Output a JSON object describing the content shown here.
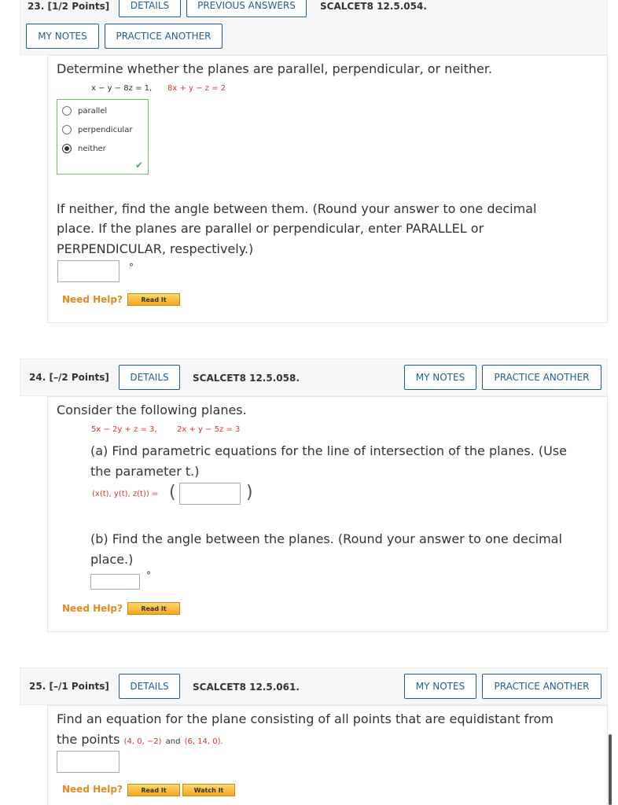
{
  "q23": {
    "header": {
      "number": "23.",
      "points": "[1/2 Points]",
      "details": "DETAILS",
      "previous_answers": "PREVIOUS ANSWERS",
      "code": "SCALCET8 12.5.054.",
      "my_notes": "MY NOTES",
      "practice_another": "PRACTICE ANOTHER"
    },
    "prompt": "Determine whether the planes are parallel, perpendicular, or neither.",
    "eq1": "x − y − 8z = 1,",
    "eq2": "8x + y − z = 2",
    "choices": [
      "parallel",
      "perpendicular",
      "neither"
    ],
    "selected_choice": "neither",
    "part2_lines": [
      "If neither, find the angle between them. (Round your answer to one decimal",
      "place. If the planes are parallel or perpendicular, enter PARALLEL or",
      "PERPENDICULAR, respectively.)"
    ],
    "answer_value": "",
    "degree": "°",
    "need_help": "Need Help?",
    "read_it": "Read It"
  },
  "q24": {
    "header": {
      "number": "24.",
      "points": "[–/2 Points]",
      "details": "DETAILS",
      "code": "SCALCET8 12.5.058.",
      "my_notes": "MY NOTES",
      "practice_another": "PRACTICE ANOTHER"
    },
    "prompt": "Consider the following planes.",
    "eq1": "5x − 2y + z = 3,",
    "eq2": "2x + y − 5z = 3",
    "part_a_lines": [
      "(a) Find parametric equations for the line of intersection of the planes. (Use",
      "the parameter t.)"
    ],
    "param_label": "(x(t), y(t), z(t)) =",
    "answer_a": "",
    "part_b_lines": [
      "(b) Find the angle between the planes. (Round your answer to one decimal",
      "place.)"
    ],
    "answer_b": "",
    "degree": "°",
    "need_help": "Need Help?",
    "read_it": "Read It"
  },
  "q25": {
    "header": {
      "number": "25.",
      "points": "[–/1 Points]",
      "details": "DETAILS",
      "code": "SCALCET8 12.5.061.",
      "my_notes": "MY NOTES",
      "practice_another": "PRACTICE ANOTHER"
    },
    "prompt_line1": "Find an equation for the plane consisting of all points that are equidistant from",
    "prompt_line2": "the points",
    "point1": "(4, 0, −2)",
    "and": "and",
    "point2": "(6, 14, 0).",
    "answer_value": "",
    "need_help": "Need Help?",
    "read_it": "Read It",
    "watch_it": "Watch It"
  },
  "colors": {
    "link_blue": "#1f5d96",
    "math_red": "#d9342b",
    "help_orange": "#e48b1f",
    "correct_green": "#4caf50"
  }
}
